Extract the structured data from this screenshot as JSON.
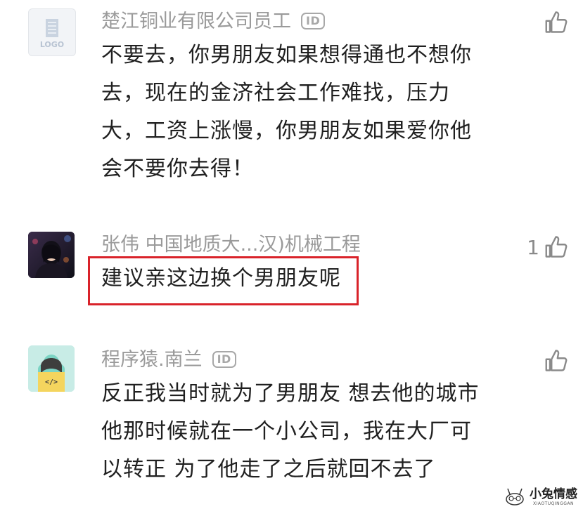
{
  "comments": [
    {
      "username": "楚江铜业有限公司员工",
      "badge": "ID",
      "avatar_text": "LOGO",
      "body_lines": [
        "不要去，你男朋友如果想得通也不想你",
        "去，现在的金济社会工作难找，压力",
        "大，工资上涨慢，你男朋友如果爱你他",
        "会不要你去得！"
      ],
      "likes": ""
    },
    {
      "username": "张伟 中国地质大...汉)机械工程",
      "body_lines": [
        "建议亲这边换个男朋友呢"
      ],
      "likes": "1"
    },
    {
      "username": "程序猿.南兰",
      "badge": "ID",
      "avatar_text": "</>",
      "body_lines": [
        "反正我当时就为了男朋友 想去他的城市",
        "他那时候就在一个小公司，我在大厂可",
        "以转正 为了他走了之后就回不去了"
      ],
      "likes": ""
    }
  ],
  "watermark": {
    "title": "小兔情感",
    "subtitle": "XIAOTUQINGGAN"
  },
  "colors": {
    "highlight": "#d9232a",
    "muted_text": "#9a9a9a",
    "body_text": "#202020"
  },
  "icons": [
    "thumbs-up-icon",
    "id-badge-icon",
    "logo-icon",
    "code-avatar-icon"
  ]
}
